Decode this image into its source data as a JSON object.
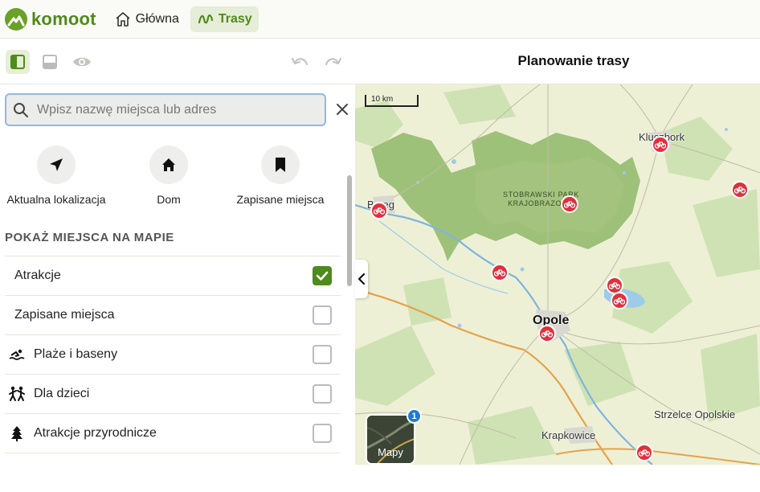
{
  "nav": {
    "brand": "komoot",
    "items": [
      {
        "label": "Główna",
        "icon": "home-icon"
      },
      {
        "label": "Trasy",
        "icon": "route-icon",
        "active": true
      }
    ]
  },
  "toolbar": {
    "buttons": [
      "panel-sidebar-icon",
      "panel-bottom-icon",
      "eye-icon",
      "undo-icon",
      "redo-icon"
    ]
  },
  "header": {
    "title": "Planowanie trasy"
  },
  "search": {
    "placeholder": "Wpisz nazwę miejsca lub adres",
    "value": ""
  },
  "quick_actions": [
    {
      "label": "Aktualna lokalizacja",
      "icon": "location-arrow-icon"
    },
    {
      "label": "Dom",
      "icon": "home-icon"
    },
    {
      "label": "Zapisane miejsca",
      "icon": "bookmark-icon"
    }
  ],
  "section": {
    "title": "POKAŻ MIEJSCA NA MAPIE"
  },
  "places": [
    {
      "label": "Atrakcje",
      "checked": true,
      "icon": ""
    },
    {
      "label": "Zapisane miejsca",
      "checked": false,
      "icon": ""
    },
    {
      "label": "Plaże i baseny",
      "checked": false,
      "icon": "swimmer-icon"
    },
    {
      "label": "Dla dzieci",
      "checked": false,
      "icon": "children-icon"
    },
    {
      "label": "Atrakcje przyrodnicze",
      "checked": false,
      "icon": "tree-icon"
    }
  ],
  "map": {
    "scale": "10 km",
    "labels": {
      "kluczbork": "Kluczbork",
      "brzeg": "Brzeg",
      "park_line1": "STOBRAWSKI PARK",
      "park_line2": "KRAJOBRAZOWY",
      "opole": "Opole",
      "strzelce": "Strzelce Opolskie",
      "krapkowice": "Krapkowice"
    },
    "layer_button": {
      "label": "Mapy",
      "badge": "1"
    },
    "colors": {
      "forest": "#b8d59a",
      "park": "#8fb96a",
      "water": "#9ecbe8",
      "road": "#e6a24a",
      "poi": "#e0303c"
    }
  }
}
